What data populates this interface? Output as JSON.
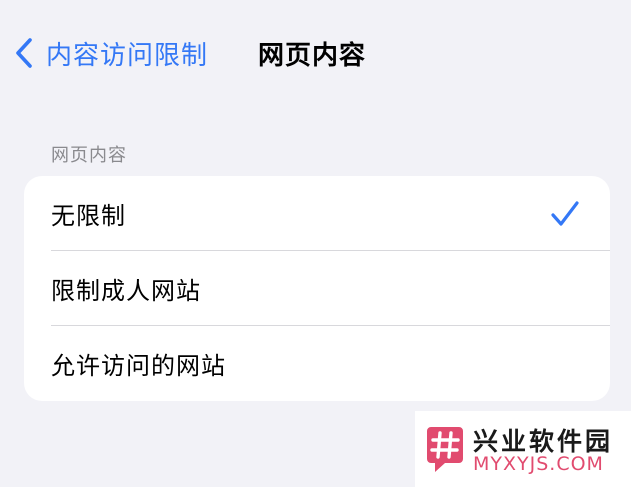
{
  "nav": {
    "back_label": "内容访问限制",
    "title": "网页内容"
  },
  "section": {
    "header": "网页内容",
    "options": [
      {
        "label": "无限制",
        "selected": true
      },
      {
        "label": "限制成人网站",
        "selected": false
      },
      {
        "label": "允许访问的网站",
        "selected": false
      }
    ]
  },
  "watermark": {
    "title": "兴业软件园",
    "url": "MYXYJS.COM"
  },
  "colors": {
    "accent": "#3478f6",
    "background": "#f2f2f7",
    "card": "#ffffff",
    "secondary_text": "#8a8a8e",
    "watermark_accent": "#e14b6f"
  },
  "icons": {
    "back": "chevron-left-icon",
    "selected": "checkmark-icon",
    "logo": "hash-logo-icon"
  }
}
